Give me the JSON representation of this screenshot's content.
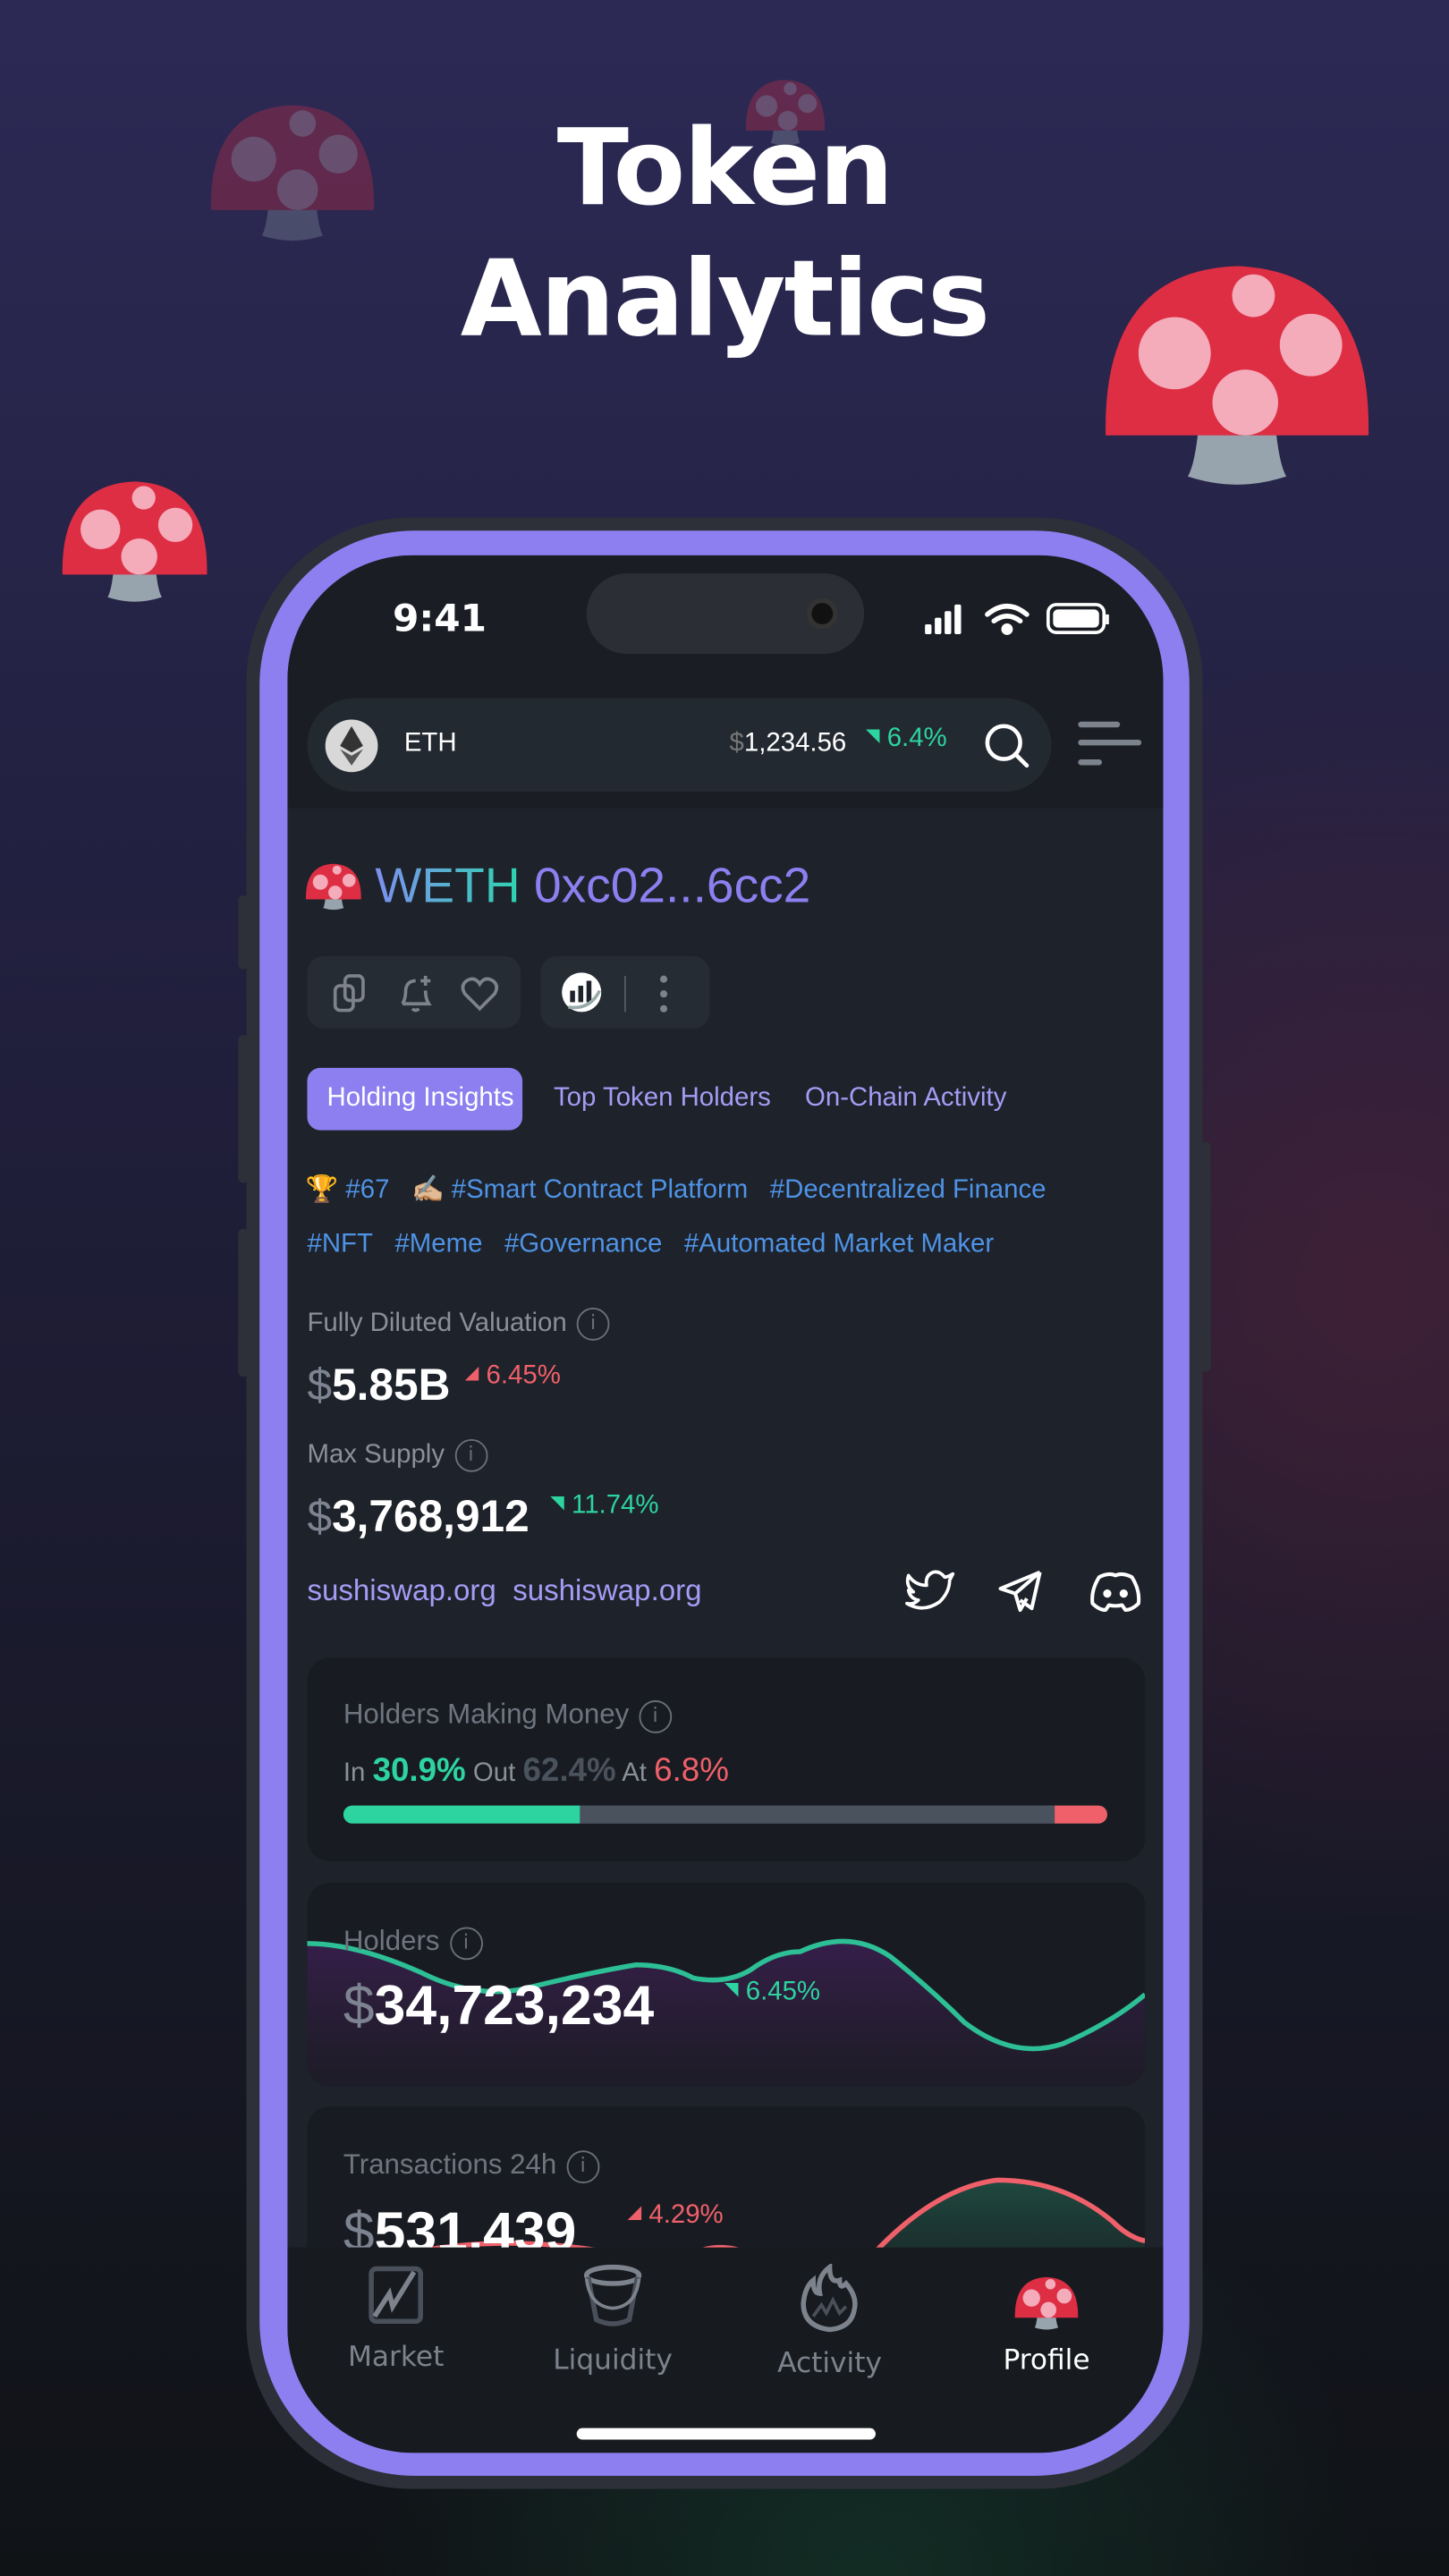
{
  "hero": {
    "line1": "Token",
    "line2": "Analytics"
  },
  "status_bar": {
    "time": "9:41"
  },
  "top_bar": {
    "coin": "ETH",
    "price_currency": "$",
    "price": "1,234.56",
    "change": "6.4%",
    "change_direction": "up",
    "icons": [
      "ethereum-icon",
      "search-icon",
      "menu-icon"
    ]
  },
  "token": {
    "symbol": "WETH",
    "address": "0xc02...6cc2",
    "actions": [
      "copy-icon",
      "bell-plus-icon",
      "heart-icon",
      "analytics-icon",
      "more-vertical-icon"
    ]
  },
  "tabs": [
    {
      "label": "Holding Insights",
      "active": true
    },
    {
      "label": "Top Token Holders",
      "active": false
    },
    {
      "label": "On-Chain Activity",
      "active": false
    }
  ],
  "tags": {
    "rank": "#67",
    "items_row1": [
      "#Smart Contract Platform",
      "#Decentralized Finance"
    ],
    "items_row2": [
      "#NFT",
      "#Meme",
      "#Governance",
      "#Automated Market Maker"
    ]
  },
  "metrics": {
    "fdv": {
      "label": "Fully Diluted Valuation",
      "currency": "$",
      "value": "5.85B",
      "change": "6.45%",
      "direction": "down"
    },
    "max_supply": {
      "label": "Max Supply",
      "currency": "$",
      "value": "3,768,912",
      "change": "11.74%",
      "direction": "up"
    }
  },
  "links": [
    "sushiswap.org",
    "sushiswap.org"
  ],
  "socials": [
    "twitter-icon",
    "telegram-icon",
    "discord-icon"
  ],
  "holders_money": {
    "label": "Holders Making Money",
    "in_label": "In",
    "in": "30.9%",
    "out_label": "Out",
    "out": "62.4%",
    "at_label": "At",
    "at": "6.8%",
    "in_pct": 30.9,
    "out_pct": 62.4,
    "at_pct": 6.8
  },
  "holders": {
    "label": "Holders",
    "currency": "$",
    "value": "34,723,234",
    "change": "6.45%",
    "direction": "up"
  },
  "transactions": {
    "label": "Transactions 24h",
    "currency": "$",
    "value": "531,439",
    "change": "4.29%",
    "direction": "down"
  },
  "nav": [
    {
      "label": "Market",
      "active": false
    },
    {
      "label": "Liquidity",
      "active": false
    },
    {
      "label": "Activity",
      "active": false
    },
    {
      "label": "Profile",
      "active": true
    }
  ],
  "colors": {
    "accent": "#8d7ff0",
    "up": "#2dd4a0",
    "down": "#f0606a",
    "tag": "#4f93e6"
  }
}
